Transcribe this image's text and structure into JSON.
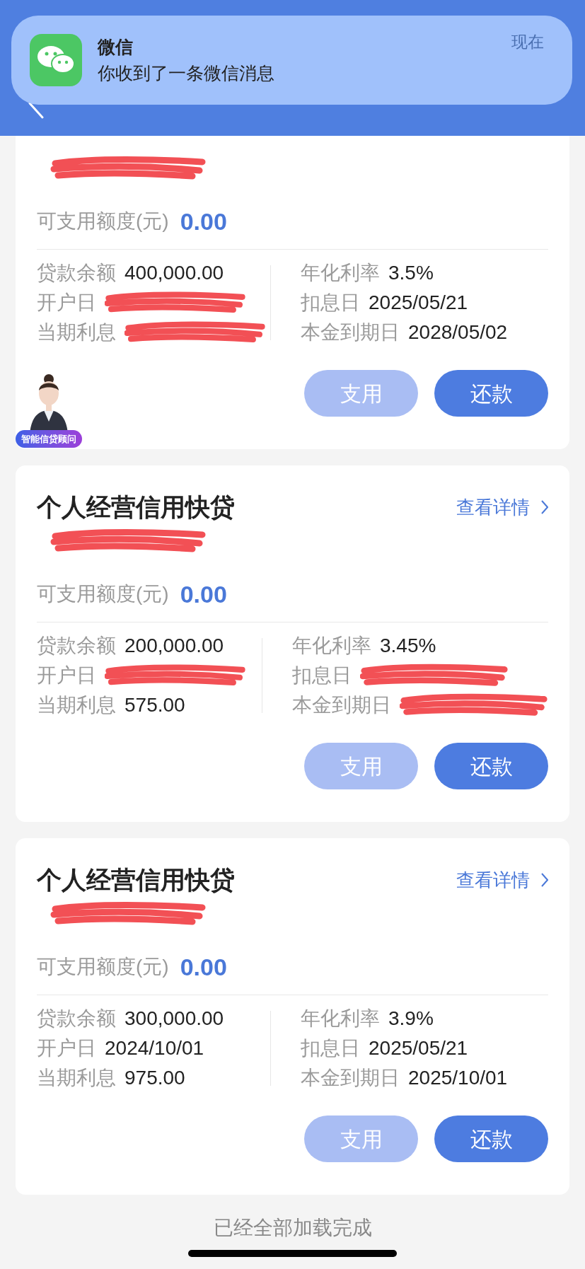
{
  "notification": {
    "app": "微信",
    "message": "你收到了一条微信消息",
    "time": "现在"
  },
  "header": {
    "back": true
  },
  "cards": [
    {
      "subtitle_redacted": true,
      "available_label": "可支用额度(元)",
      "available_value": "0.00",
      "left_fields": [
        {
          "label": "贷款余额",
          "value": "400,000.00",
          "redacted": false
        },
        {
          "label": "开户日",
          "redacted": true
        },
        {
          "label": "当期利息",
          "redacted": true
        }
      ],
      "right_fields": [
        {
          "label": "年化利率",
          "value": "3.5%",
          "redacted": false
        },
        {
          "label": "扣息日",
          "value": "2025/05/21",
          "redacted": false
        },
        {
          "label": "本金到期日",
          "value": "2028/05/02",
          "redacted": false
        }
      ],
      "buttons": [
        {
          "label": "支用",
          "kind": "secondary"
        },
        {
          "label": "还款",
          "kind": "primary"
        }
      ],
      "advisor": {
        "badge": "智能信贷顾问"
      }
    },
    {
      "title": "个人经营信用快贷",
      "detail_link": "查看详情",
      "subtitle_redacted": true,
      "available_label": "可支用额度(元)",
      "available_value": "0.00",
      "left_fields": [
        {
          "label": "贷款余额",
          "value": "200,000.00",
          "redacted": false
        },
        {
          "label": "开户日",
          "redacted": true
        },
        {
          "label": "当期利息",
          "value": "575.00",
          "redacted": false
        }
      ],
      "right_fields": [
        {
          "label": "年化利率",
          "value": "3.45%",
          "redacted": false
        },
        {
          "label": "扣息日",
          "redacted": true
        },
        {
          "label": "本金到期日",
          "redacted": true
        }
      ],
      "buttons": [
        {
          "label": "支用",
          "kind": "secondary"
        },
        {
          "label": "还款",
          "kind": "primary"
        }
      ]
    },
    {
      "title": "个人经营信用快贷",
      "detail_link": "查看详情",
      "subtitle_redacted": true,
      "available_label": "可支用额度(元)",
      "available_value": "0.00",
      "left_fields": [
        {
          "label": "贷款余额",
          "value": "300,000.00",
          "redacted": false
        },
        {
          "label": "开户日",
          "value": "2024/10/01",
          "redacted": false
        },
        {
          "label": "当期利息",
          "value": "975.00",
          "redacted": false
        }
      ],
      "right_fields": [
        {
          "label": "年化利率",
          "value": "3.9%",
          "redacted": false
        },
        {
          "label": "扣息日",
          "value": "2025/05/21",
          "redacted": false
        },
        {
          "label": "本金到期日",
          "value": "2025/10/01",
          "redacted": false
        }
      ],
      "buttons": [
        {
          "label": "支用",
          "kind": "secondary"
        },
        {
          "label": "还款",
          "kind": "primary"
        }
      ]
    }
  ],
  "footer": "已经全部加载完成"
}
